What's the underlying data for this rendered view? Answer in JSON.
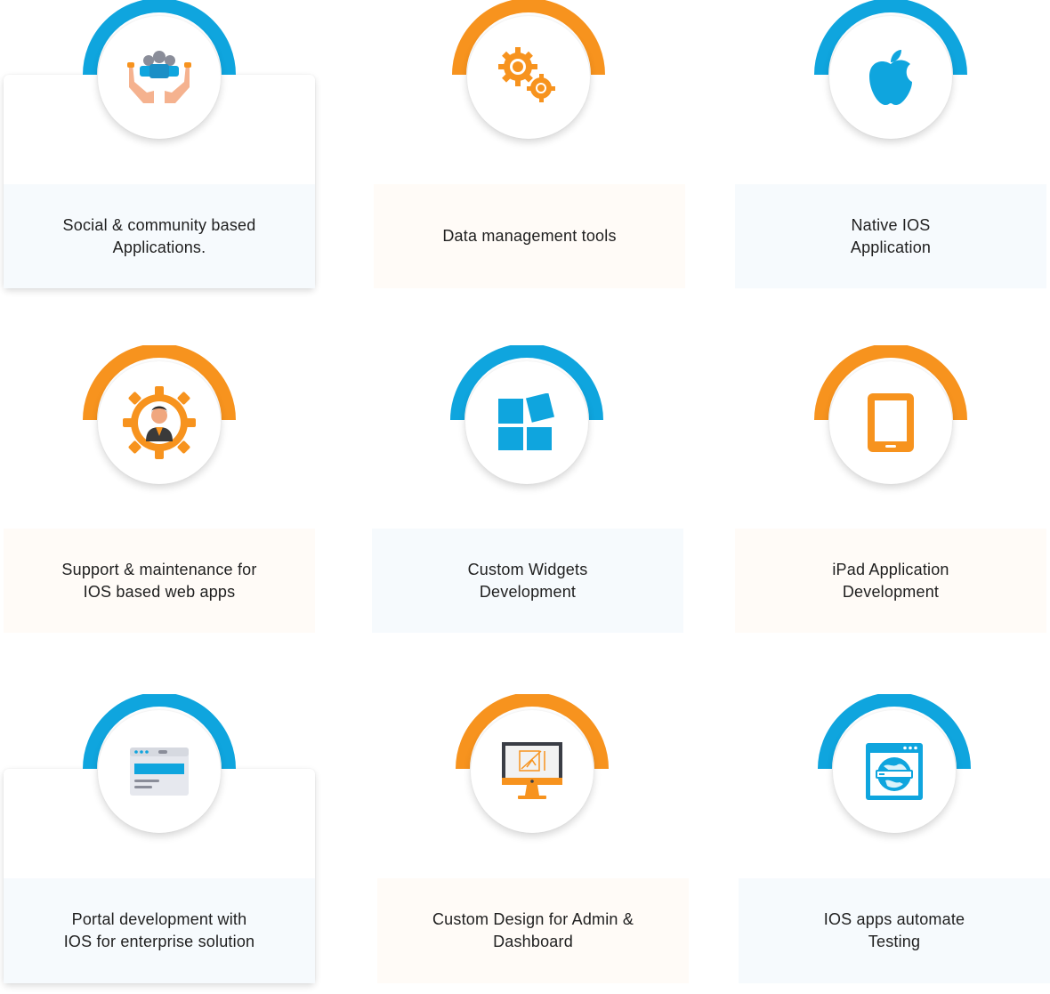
{
  "colors": {
    "blue": "#0fa5de",
    "orange": "#f7931e",
    "text": "#1f1f1f"
  },
  "services": [
    {
      "label": "Social & community based\nApplications.",
      "icon": "hands-community-icon",
      "accent": "blue"
    },
    {
      "label": "Data management tools",
      "icon": "gears-icon",
      "accent": "orange"
    },
    {
      "label": "Native IOS\nApplication",
      "icon": "apple-icon",
      "accent": "blue"
    },
    {
      "label": "Support & maintenance for\nIOS based web apps",
      "icon": "support-gear-person-icon",
      "accent": "orange"
    },
    {
      "label": "Custom Widgets\nDevelopment",
      "icon": "widgets-icon",
      "accent": "blue"
    },
    {
      "label": "iPad Application\nDevelopment",
      "icon": "tablet-icon",
      "accent": "orange"
    },
    {
      "label": "Portal development with\nIOS for enterprise solution",
      "icon": "portal-window-icon",
      "accent": "blue"
    },
    {
      "label": "Custom Design for Admin &\nDashboard",
      "icon": "monitor-design-icon",
      "accent": "orange"
    },
    {
      "label": "IOS apps automate\nTesting",
      "icon": "browser-globe-icon",
      "accent": "blue"
    }
  ]
}
